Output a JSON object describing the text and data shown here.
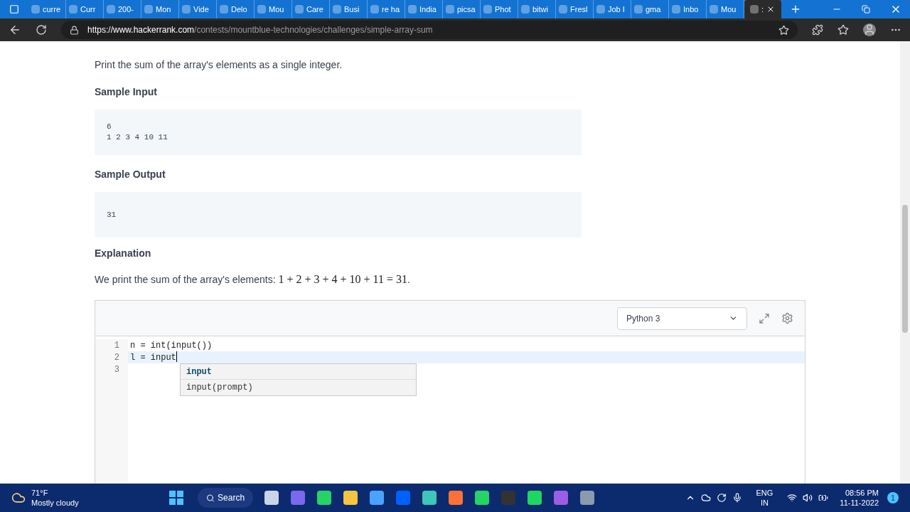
{
  "browser": {
    "tabs": [
      {
        "label": "curre",
        "selected": false
      },
      {
        "label": "Curr",
        "selected": false
      },
      {
        "label": "200-",
        "selected": false
      },
      {
        "label": "Mon",
        "selected": false
      },
      {
        "label": "Vide",
        "selected": false
      },
      {
        "label": "Delo",
        "selected": false
      },
      {
        "label": "Mou",
        "selected": false
      },
      {
        "label": "Care",
        "selected": false
      },
      {
        "label": "Busi",
        "selected": false
      },
      {
        "label": "re ha",
        "selected": false
      },
      {
        "label": "India",
        "selected": false
      },
      {
        "label": "picsa",
        "selected": false
      },
      {
        "label": "Phot",
        "selected": false
      },
      {
        "label": "bitwi",
        "selected": false
      },
      {
        "label": "Fresl",
        "selected": false
      },
      {
        "label": "Job I",
        "selected": false
      },
      {
        "label": "gma",
        "selected": false
      },
      {
        "label": "Inbo",
        "selected": false
      },
      {
        "label": "Mou",
        "selected": false
      },
      {
        "label": ":",
        "selected": true
      }
    ],
    "url_host": "https://www.hackerrank.com",
    "url_path": "/contests/mountblue-technologies/challenges/simple-array-sum"
  },
  "problem": {
    "output_text": "Print the sum of the array's elements as a single integer.",
    "sections": [
      {
        "heading": "Sample Input",
        "lines": [
          "6",
          "1 2 3 4 10 11"
        ]
      },
      {
        "heading": "Sample Output",
        "lines": [
          "31"
        ]
      }
    ],
    "explanation_heading": "Explanation",
    "explanation_text": "We print the sum of the array's elements: ",
    "explanation_math": "1 + 2 + 3 + 4 + 10 + 11 = 31",
    "explanation_end": "."
  },
  "editor": {
    "language": "Python 3",
    "lines": [
      {
        "number": "1",
        "code": "n = int(input())",
        "current": false
      },
      {
        "number": "2",
        "code": "l = input",
        "current": true
      },
      {
        "number": "3",
        "current": false
      }
    ],
    "suggestions": [
      {
        "text": "input",
        "selected": true
      },
      {
        "text": "input(prompt)",
        "selected": false
      }
    ]
  },
  "taskbar": {
    "temperature": "71°F",
    "weather": "Mostly cloudy",
    "search": "Search",
    "lang": "ENG",
    "region": "IN",
    "time": "08:56 PM",
    "date": "11-11-2022",
    "notifications": "1"
  }
}
